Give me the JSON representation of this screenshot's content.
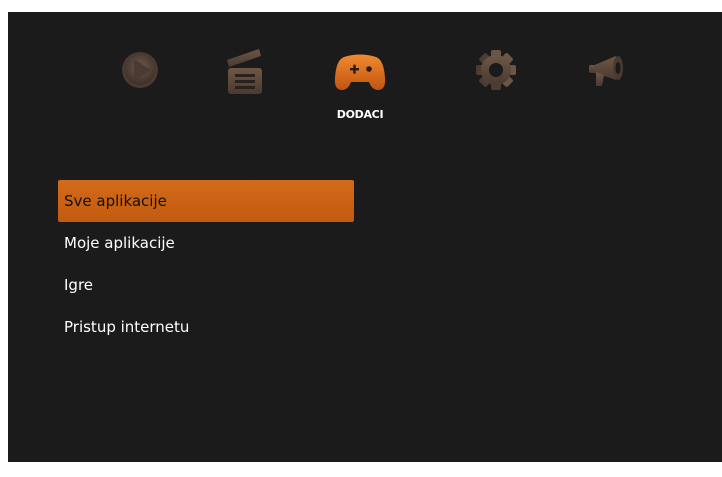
{
  "category_bar": {
    "icons": [
      "play-icon",
      "clapperboard-icon",
      "gamepad-icon",
      "gear-icon",
      "megaphone-icon"
    ],
    "active_label": "DODACI"
  },
  "menu": {
    "items": [
      {
        "label": "Sve aplikacije",
        "selected": true
      },
      {
        "label": "Moje aplikacije",
        "selected": false
      },
      {
        "label": "Igre",
        "selected": false
      },
      {
        "label": "Pristup internetu",
        "selected": false
      }
    ]
  },
  "colors": {
    "background": "#1b1b1b",
    "accent": "#d36a1a",
    "inactive_icon": "#5a4a40",
    "text": "#ffffff"
  }
}
